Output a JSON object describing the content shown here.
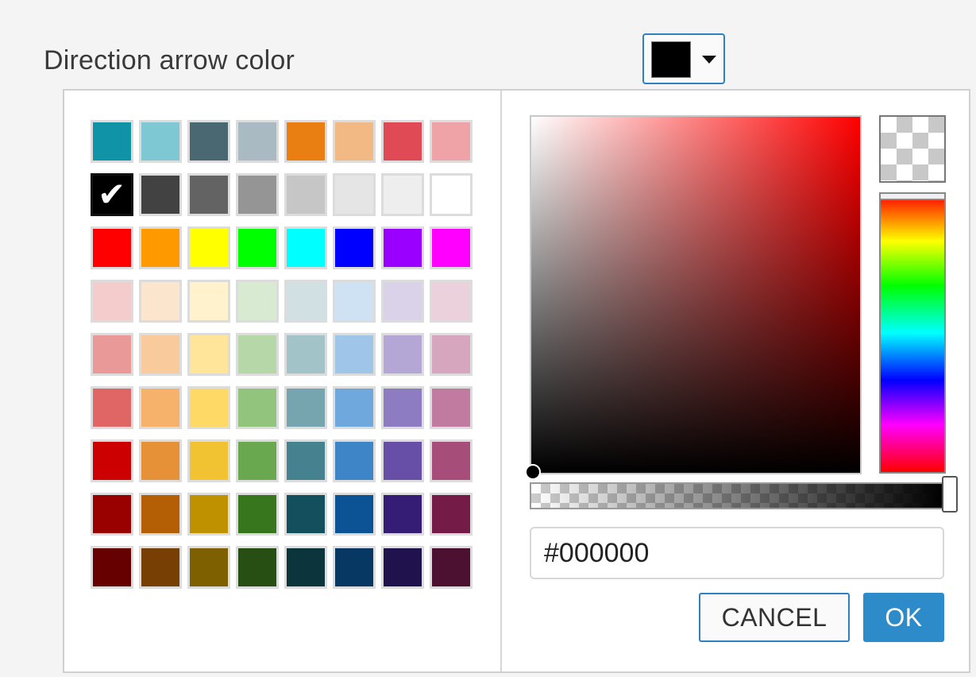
{
  "field": {
    "label": "Direction arrow color",
    "current_color": "#000000"
  },
  "picker": {
    "hex_value": "#000000",
    "buttons": {
      "cancel": "CANCEL",
      "ok": "OK"
    },
    "selected_swatch": "#000000",
    "selection_mark": "✔",
    "hue": "#ff0000",
    "alpha_percent": 100,
    "palette_rows": [
      [
        "#1093a7",
        "#7ec8d3",
        "#4a6872",
        "#a9bac2",
        "#e97e12",
        "#f3b985",
        "#e04a55",
        "#f0a3a7"
      ],
      [
        "#000000",
        "#424242",
        "#636363",
        "#959595",
        "#c6c6c6",
        "#e5e5e5",
        "#eeeeee",
        "#ffffff"
      ],
      [
        "#ff0000",
        "#ff9900",
        "#ffff00",
        "#00ff00",
        "#00ffff",
        "#0000ff",
        "#9900ff",
        "#ff00ff"
      ],
      [
        "#f4cccc",
        "#fce5cd",
        "#fff2cc",
        "#d9ead3",
        "#d0e0e3",
        "#cfe2f3",
        "#d9d2e9",
        "#ead1dc"
      ],
      [
        "#ea9999",
        "#f9cb9c",
        "#ffe599",
        "#b6d7a8",
        "#a2c4c9",
        "#9fc5e8",
        "#b4a7d6",
        "#d5a6bd"
      ],
      [
        "#e06666",
        "#f6b26b",
        "#ffd966",
        "#93c47d",
        "#76a5af",
        "#6fa8dc",
        "#8e7cc3",
        "#c27ba0"
      ],
      [
        "#cc0000",
        "#e69138",
        "#f1c232",
        "#6aa84f",
        "#45818e",
        "#3d85c6",
        "#674ea7",
        "#a64d79"
      ],
      [
        "#990000",
        "#b45f06",
        "#bf9000",
        "#38761d",
        "#134f5c",
        "#0b5394",
        "#351c75",
        "#741b47"
      ],
      [
        "#660000",
        "#783f04",
        "#7f6000",
        "#274e13",
        "#0c343d",
        "#073763",
        "#20124d",
        "#4c1130"
      ]
    ]
  }
}
